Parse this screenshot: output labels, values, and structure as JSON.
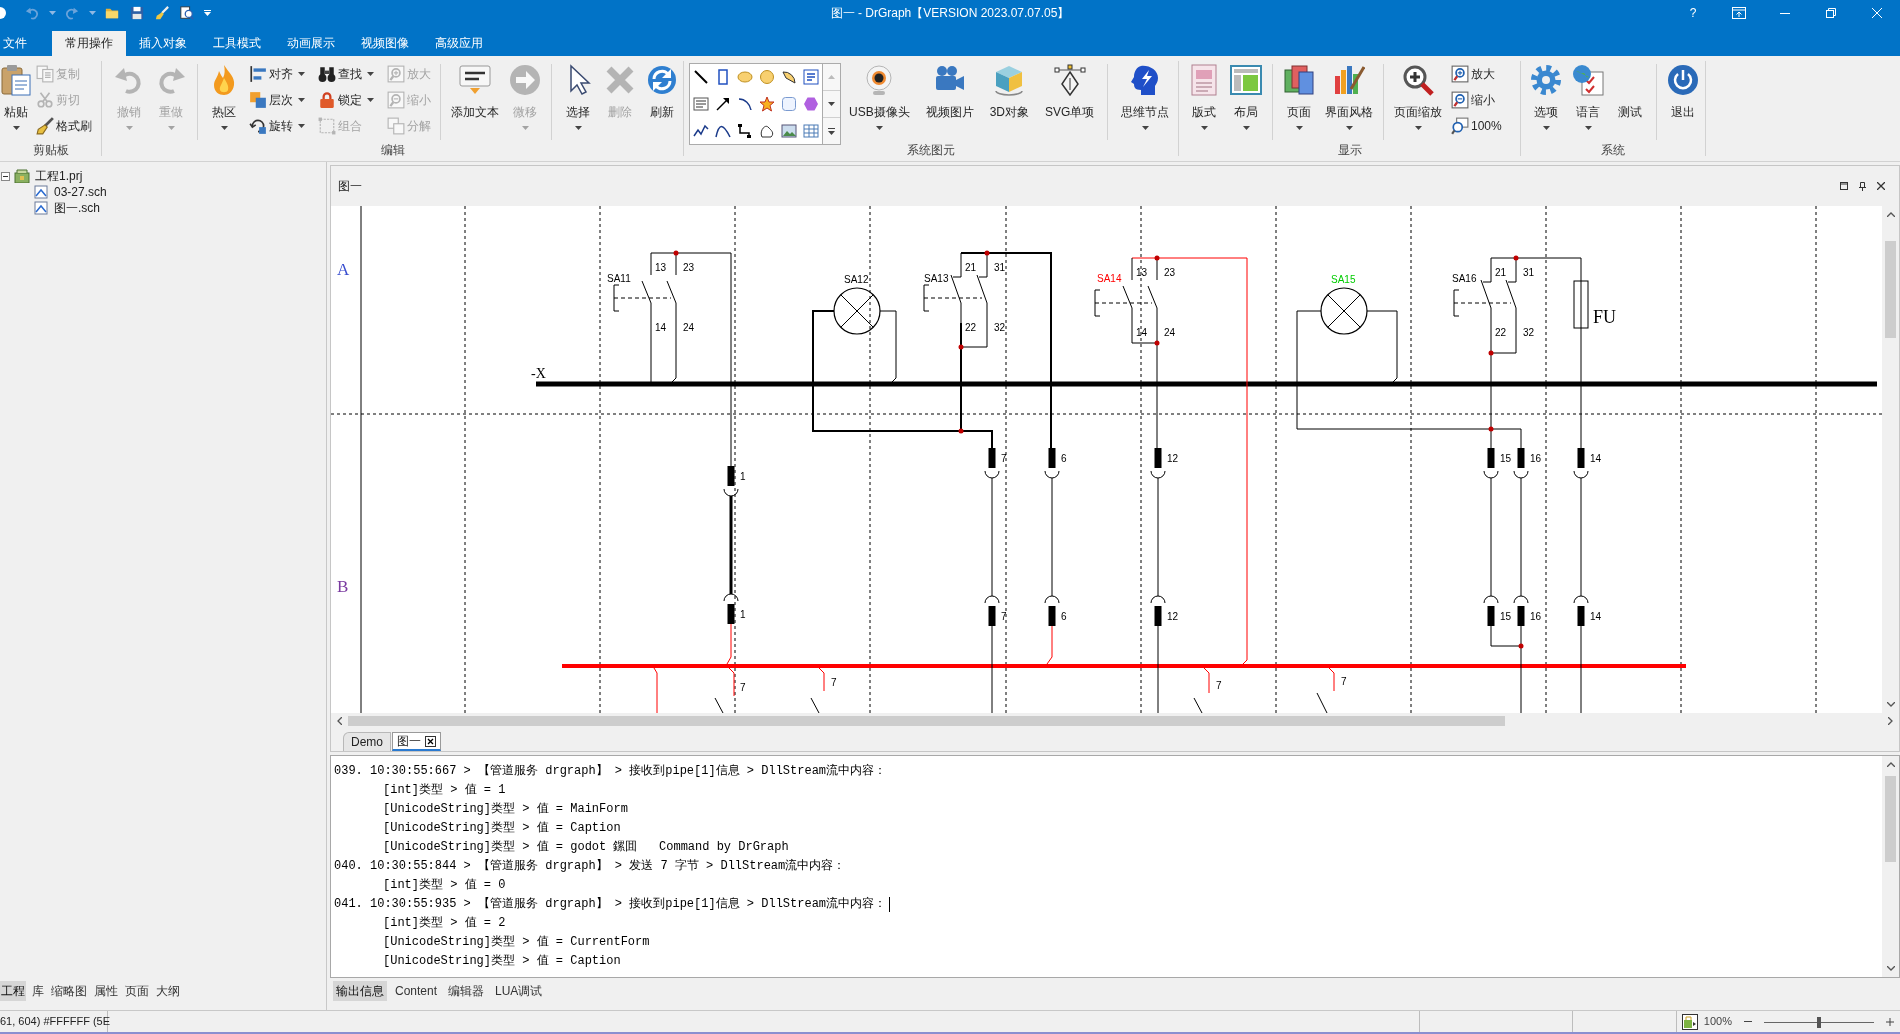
{
  "title_bar": {
    "quick_access": [
      {
        "disabled": true,
        "dropdown": true
      },
      {
        "disabled": true,
        "dropdown": true
      },
      {
        "disabled": false,
        "dropdown": false
      },
      {
        "disabled": false,
        "dropdown": false
      },
      {
        "disabled": false,
        "dropdown": false
      },
      {
        "disabled": false,
        "dropdown": false
      }
    ],
    "title": "图一 - DrGraph【VERSION 2023.07.07.05】",
    "help": "?"
  },
  "ribbon_tabs": [
    {
      "label": "文件",
      "selected": false
    },
    {
      "label": "常用操作",
      "selected": true
    },
    {
      "label": "插入对象",
      "selected": false
    },
    {
      "label": "工具模式",
      "selected": false
    },
    {
      "label": "动画展示",
      "selected": false
    },
    {
      "label": "视频图像",
      "selected": false
    },
    {
      "label": "高级应用",
      "selected": false
    }
  ],
  "ribbon_groups": [
    {
      "label": "剪贴板",
      "columns": [
        {
          "kind": "large",
          "label": "粘贴",
          "disabled": false,
          "dropdown": true
        },
        {
          "kind": "stack",
          "buttons": [
            {
              "label": "复制",
              "disabled": true,
              "dropdown": false
            },
            {
              "label": "剪切",
              "disabled": true,
              "dropdown": false
            },
            {
              "label": "格式刷",
              "disabled": false,
              "dropdown": false
            }
          ]
        }
      ]
    },
    {
      "label": "编辑",
      "columns": [
        {
          "kind": "large",
          "label": "撤销",
          "disabled": true,
          "dropdown": true
        },
        {
          "kind": "large",
          "label": "重做",
          "disabled": true,
          "dropdown": true
        },
        {
          "kind": "separator"
        },
        {
          "kind": "large",
          "label": "热区",
          "disabled": false,
          "dropdown": true
        },
        {
          "kind": "stack",
          "buttons": [
            {
              "label": "对齐",
              "disabled": false,
              "dropdown": true
            },
            {
              "label": "层次",
              "disabled": false,
              "dropdown": true
            },
            {
              "label": "旋转",
              "disabled": false,
              "dropdown": true
            }
          ]
        },
        {
          "kind": "stack",
          "buttons": [
            {
              "label": "查找",
              "disabled": false,
              "dropdown": true
            },
            {
              "label": "锁定",
              "disabled": false,
              "dropdown": true
            },
            {
              "label": "组合",
              "disabled": true,
              "dropdown": false
            }
          ]
        },
        {
          "kind": "stack",
          "buttons": [
            {
              "label": "放大",
              "disabled": true,
              "dropdown": false
            },
            {
              "label": "缩小",
              "disabled": true,
              "dropdown": false
            },
            {
              "label": "分解",
              "disabled": true,
              "dropdown": false
            }
          ]
        },
        {
          "kind": "separator"
        },
        {
          "kind": "large",
          "label": "添加文本",
          "disabled": false,
          "dropdown": false
        },
        {
          "kind": "large",
          "label": "微移",
          "disabled": true,
          "dropdown": true
        },
        {
          "kind": "separator"
        },
        {
          "kind": "large",
          "label": "选择",
          "disabled": false,
          "dropdown": true
        },
        {
          "kind": "large",
          "label": "删除",
          "disabled": true,
          "dropdown": false
        },
        {
          "kind": "large",
          "label": "刷新",
          "disabled": false,
          "dropdown": false
        }
      ]
    },
    {
      "label": "系统图元",
      "columns": [
        {
          "kind": "gallery"
        },
        {
          "kind": "large",
          "label": "USB摄像头",
          "disabled": false,
          "dropdown": true
        },
        {
          "kind": "large",
          "label": "视频图片",
          "disabled": false,
          "dropdown": false
        },
        {
          "kind": "large",
          "label": "3D对象",
          "disabled": false,
          "dropdown": false
        },
        {
          "kind": "large",
          "label": "SVG单项",
          "disabled": false,
          "dropdown": false
        },
        {
          "kind": "separator"
        },
        {
          "kind": "large",
          "label": "思维节点",
          "disabled": false,
          "dropdown": true
        }
      ]
    },
    {
      "label": "显示",
      "columns": [
        {
          "kind": "large",
          "label": "版式",
          "disabled": false,
          "dropdown": true
        },
        {
          "kind": "large",
          "label": "布局",
          "disabled": false,
          "dropdown": true
        },
        {
          "kind": "separator"
        },
        {
          "kind": "large",
          "label": "页面",
          "disabled": false,
          "dropdown": true
        },
        {
          "kind": "large",
          "label": "界面风格",
          "disabled": false,
          "dropdown": true
        },
        {
          "kind": "separator"
        },
        {
          "kind": "large",
          "label": "页面缩放",
          "disabled": false,
          "dropdown": true
        },
        {
          "kind": "stack",
          "buttons": [
            {
              "label": "放大",
              "disabled": false,
              "dropdown": false
            },
            {
              "label": "缩小",
              "disabled": false,
              "dropdown": false
            },
            {
              "label": "100%",
              "disabled": false,
              "dropdown": false
            }
          ]
        }
      ]
    },
    {
      "label": "系统",
      "columns": [
        {
          "kind": "large",
          "label": "选项",
          "disabled": false,
          "dropdown": true
        },
        {
          "kind": "large",
          "label": "语言",
          "disabled": false,
          "dropdown": true
        },
        {
          "kind": "large",
          "label": "测试",
          "disabled": false,
          "dropdown": false
        },
        {
          "kind": "separator"
        },
        {
          "kind": "large",
          "label": "退出",
          "disabled": false,
          "dropdown": false
        }
      ]
    }
  ],
  "project_tree": [
    {
      "label": "工程1.prj",
      "expanded": true,
      "children": [
        {
          "label": "03-27.sch"
        },
        {
          "label": "图一.sch"
        }
      ]
    }
  ],
  "panel_tabs": [
    {
      "label": "工程",
      "selected": true
    },
    {
      "label": "库",
      "selected": false
    },
    {
      "label": "缩略图",
      "selected": false
    },
    {
      "label": "属性",
      "selected": false
    },
    {
      "label": "页面",
      "selected": false
    },
    {
      "label": "大纲",
      "selected": false
    }
  ],
  "document": {
    "title": "图一",
    "diagram": {
      "row_labels": [
        {
          "text": "A",
          "color": "#3a4fd0"
        },
        {
          "text": "B",
          "color": "#7a3aa0"
        }
      ],
      "buses": [
        {
          "label": "-X",
          "color": "#000000"
        },
        {
          "color": "#ff0000"
        }
      ],
      "components": [
        {
          "kind": "switch_no",
          "label": "SA11",
          "color": "#000000",
          "pins": [
            "13",
            "23",
            "14",
            "24"
          ]
        },
        {
          "kind": "lamp",
          "label": "SA12",
          "color": "#000000"
        },
        {
          "kind": "switch_nc",
          "label": "SA13",
          "color": "#000000",
          "pins": [
            "21",
            "31",
            "22",
            "32"
          ]
        },
        {
          "kind": "switch_no",
          "label": "SA14",
          "color": "#ff0000",
          "pins": [
            "13",
            "23",
            "14",
            "24"
          ]
        },
        {
          "kind": "lamp",
          "label": "SA15",
          "color": "#00cc00"
        },
        {
          "kind": "switch_nc",
          "label": "SA16",
          "color": "#000000",
          "pins": [
            "21",
            "31",
            "22",
            "32"
          ]
        },
        {
          "kind": "fuse",
          "label": "FU",
          "color": "#000000"
        }
      ],
      "terminals": [
        {
          "upper": "1",
          "lower": "1"
        },
        {
          "upper": "7",
          "lower": "7"
        },
        {
          "upper": "6",
          "lower": "6"
        },
        {
          "upper": "12",
          "lower": "12"
        },
        {
          "upper": "15",
          "lower": "15"
        },
        {
          "upper": "16",
          "lower": "16"
        },
        {
          "upper": "14",
          "lower": "14"
        }
      ],
      "wire_numbers": [
        "7",
        "7",
        "7",
        "7"
      ]
    },
    "tabs": [
      {
        "label": "Demo",
        "selected": false
      },
      {
        "label": "图一",
        "selected": true
      }
    ]
  },
  "output_log": {
    "lines": [
      {
        "kind": "entry",
        "text": "039. 10:30:55:667 > 【管道服务 drgraph】 > 接收到pipe[1]信息 > DllStream流中内容：",
        "caret": false
      },
      {
        "kind": "detail",
        "text": "[int]类型 > 值 = 1",
        "caret": false
      },
      {
        "kind": "detail",
        "text": "[UnicodeString]类型 > 值 = MainForm",
        "caret": false
      },
      {
        "kind": "detail",
        "text": "[UnicodeString]类型 > 值 = Caption",
        "caret": false
      },
      {
        "kind": "detail",
        "text": "[UnicodeString]类型 > 值 = godot 鏍囬   Command by DrGraph",
        "caret": false
      },
      {
        "kind": "entry",
        "text": "040. 10:30:55:844 > 【管道服务 drgraph】 > 发送 7 字节 > DllStream流中内容：",
        "caret": false
      },
      {
        "kind": "detail",
        "text": "[int]类型 > 值 = 0",
        "caret": false
      },
      {
        "kind": "entry",
        "text": "041. 10:30:55:935 > 【管道服务 drgraph】 > 接收到pipe[1]信息 > DllStream流中内容：",
        "caret": true
      },
      {
        "kind": "detail",
        "text": "[int]类型 > 值 = 2",
        "caret": false
      },
      {
        "kind": "detail",
        "text": "[UnicodeString]类型 > 值 = CurrentForm",
        "caret": false
      },
      {
        "kind": "detail",
        "text": "[UnicodeString]类型 > 值 = Caption",
        "caret": false
      }
    ]
  },
  "output_tabs": [
    {
      "label": "输出信息",
      "selected": true
    },
    {
      "label": "Content",
      "selected": false
    },
    {
      "label": "编辑器",
      "selected": false
    },
    {
      "label": "LUA调试",
      "selected": false
    }
  ],
  "status_bar": {
    "cursor_info": "61, 604) #FFFFFF (5E",
    "zoom": "100%",
    "zoom_slider": {
      "level": 0.5
    }
  }
}
